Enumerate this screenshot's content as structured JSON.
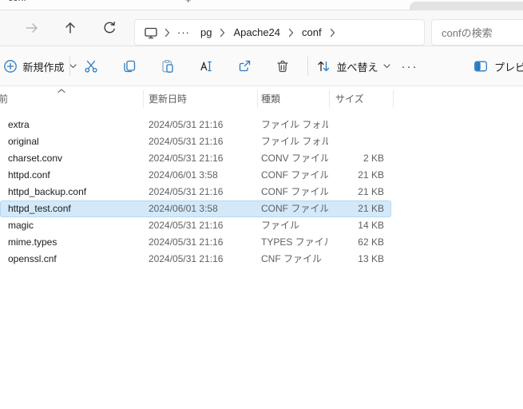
{
  "colors": {
    "accent_blue": "#2b7bc0",
    "selection_bg": "#d3e9fa",
    "selection_border": "#b5d7ef",
    "chrome_bg": "#f8f8f8",
    "divider": "#e2e2e2",
    "secondary_text": "#5f5f5f"
  },
  "tab_bar": {
    "active_tab_title": "conf",
    "new_tab_label": "+"
  },
  "navigation": {
    "breadcrumbs": [
      "pg",
      "Apache24",
      "conf"
    ],
    "overflow_label": "···",
    "search_placeholder": "confの検索"
  },
  "toolbar": {
    "new_label": "新規作成",
    "sort_label": "並べ替え",
    "more_label": "···",
    "preview_label": "プレビュー"
  },
  "list": {
    "columns": [
      "名前",
      "更新日時",
      "種類",
      "サイズ"
    ],
    "sort_column": "名前",
    "sort_direction": "ascending",
    "rows": [
      {
        "name": "extra",
        "modified": "2024/05/31 21:16",
        "type": "ファイル フォル...",
        "size": "",
        "selected": false
      },
      {
        "name": "original",
        "modified": "2024/05/31 21:16",
        "type": "ファイル フォル...",
        "size": "",
        "selected": false
      },
      {
        "name": "charset.conv",
        "modified": "2024/05/31 21:16",
        "type": "CONV ファイル",
        "size": "2 KB",
        "selected": false
      },
      {
        "name": "httpd.conf",
        "modified": "2024/06/01 3:58",
        "type": "CONF ファイル",
        "size": "21 KB",
        "selected": false
      },
      {
        "name": "httpd_backup.conf",
        "modified": "2024/05/31 21:16",
        "type": "CONF ファイル",
        "size": "21 KB",
        "selected": false
      },
      {
        "name": "httpd_test.conf",
        "modified": "2024/06/01 3:58",
        "type": "CONF ファイル",
        "size": "21 KB",
        "selected": true
      },
      {
        "name": "magic",
        "modified": "2024/05/31 21:16",
        "type": "ファイル",
        "size": "14 KB",
        "selected": false
      },
      {
        "name": "mime.types",
        "modified": "2024/05/31 21:16",
        "type": "TYPES ファイル",
        "size": "62 KB",
        "selected": false
      },
      {
        "name": "openssl.cnf",
        "modified": "2024/05/31 21:16",
        "type": "CNF ファイル",
        "size": "13 KB",
        "selected": false
      }
    ]
  }
}
